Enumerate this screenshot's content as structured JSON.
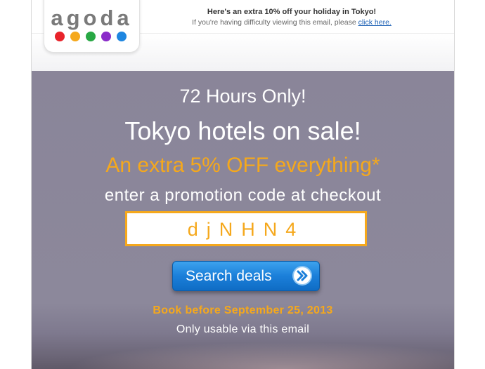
{
  "header": {
    "logo_text": "agoda",
    "logo_dot_colors": [
      "#e8232a",
      "#f5a81c",
      "#28a844",
      "#8a2bc9",
      "#1e86e0"
    ],
    "title": "Here's an extra 10% off your holiday in Tokyo!",
    "subtitle": "If you're having difficulty viewing this email, please",
    "link_text": "click here."
  },
  "hero": {
    "line1": "72 Hours Only!",
    "line2": "Tokyo hotels on sale!",
    "line3": "An extra 5% OFF everything*",
    "line4": "enter a promotion code at checkout",
    "promo_code": "djNHN4",
    "button_label": "Search deals",
    "button_icon": "double-chevron-right-icon",
    "deadline": "Book before September 25, 2013",
    "note": "Only usable via this email"
  },
  "colors": {
    "accent_orange": "#f5a81c",
    "hero_bg": "#8a8599",
    "button_blue": "#1b7fd9"
  }
}
